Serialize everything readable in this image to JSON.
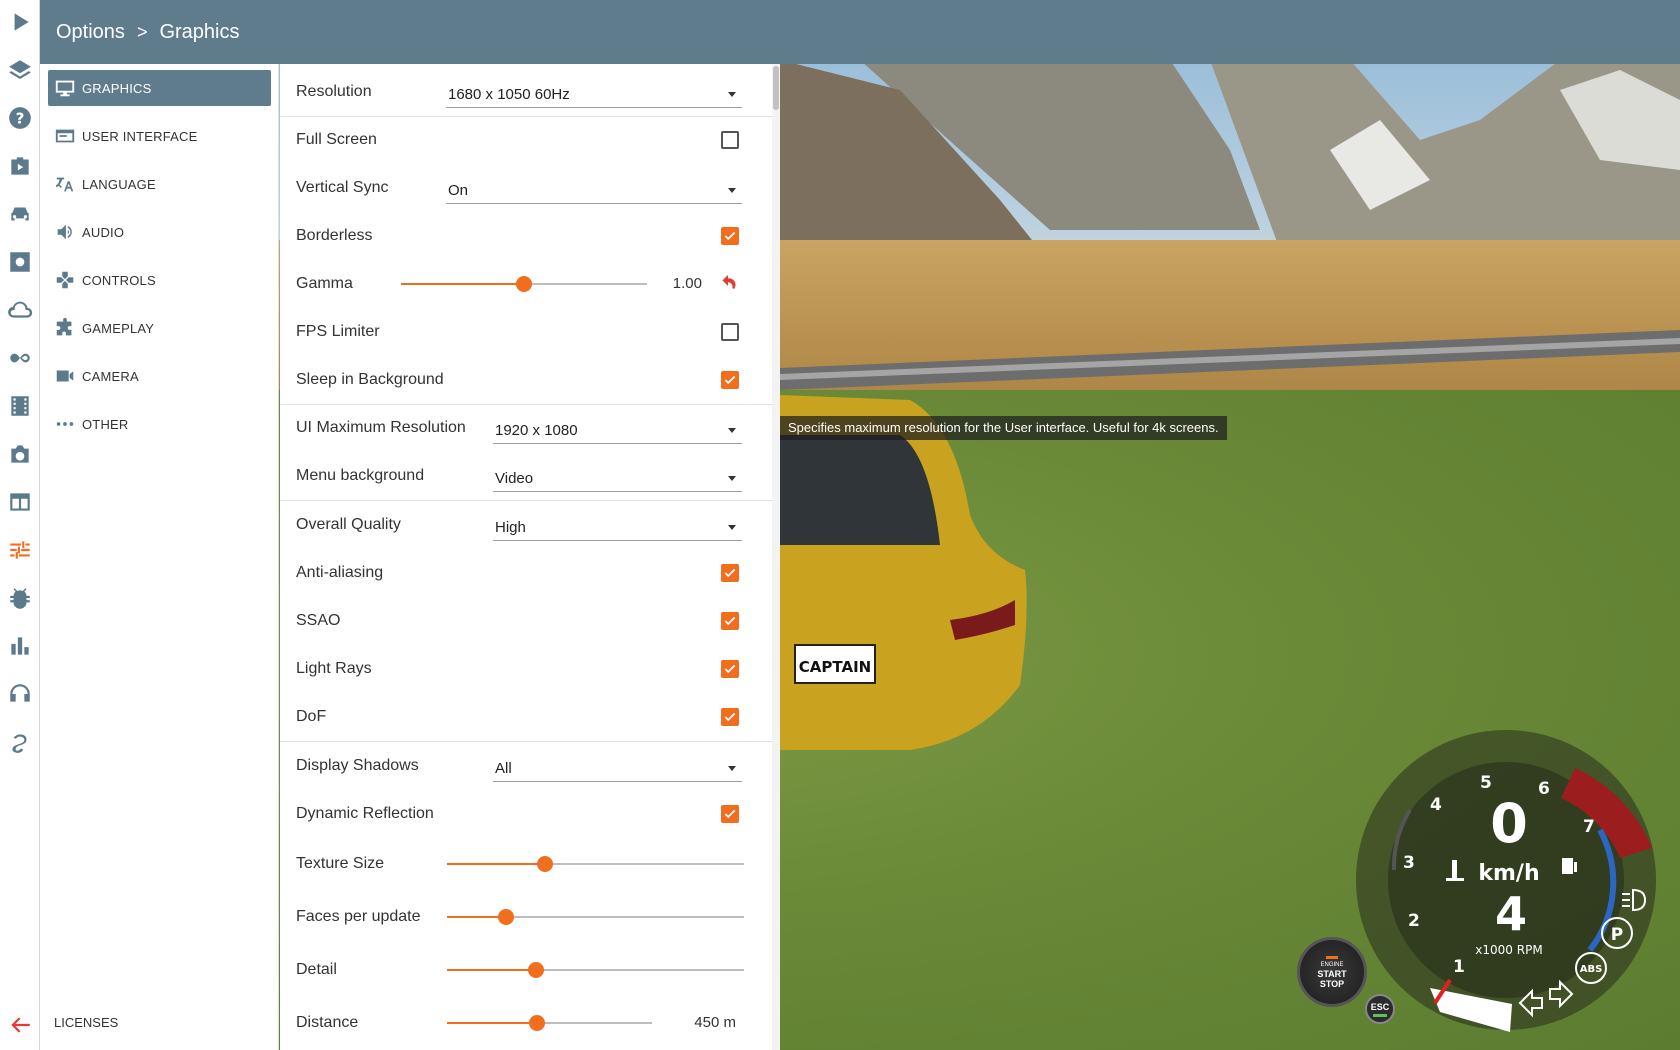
{
  "title": {
    "section": "Options",
    "separator": ">",
    "page": "Graphics"
  },
  "rail": {
    "items": [
      {
        "name": "play-icon"
      },
      {
        "name": "layers-icon"
      },
      {
        "name": "help-icon"
      },
      {
        "name": "missions-icon"
      },
      {
        "name": "vehicles-icon"
      },
      {
        "name": "vehicle-config-icon"
      },
      {
        "name": "cloud-icon"
      },
      {
        "name": "infinity-icon"
      },
      {
        "name": "film-icon"
      },
      {
        "name": "camera-icon"
      },
      {
        "name": "layout-icon"
      },
      {
        "name": "options-icon"
      },
      {
        "name": "bug-icon"
      },
      {
        "name": "stats-icon"
      },
      {
        "name": "headphones-icon"
      },
      {
        "name": "route-icon"
      }
    ],
    "active": "options-icon",
    "back": "back-arrow-icon"
  },
  "menu": {
    "items": [
      {
        "label": "GRAPHICS",
        "icon": "monitor-icon",
        "active": true
      },
      {
        "label": "USER INTERFACE",
        "icon": "ui-window-icon"
      },
      {
        "label": "LANGUAGE",
        "icon": "translate-icon"
      },
      {
        "label": "AUDIO",
        "icon": "speaker-icon"
      },
      {
        "label": "CONTROLS",
        "icon": "gamepad-icon"
      },
      {
        "label": "GAMEPLAY",
        "icon": "puzzle-icon"
      },
      {
        "label": "CAMERA",
        "icon": "video-camera-icon"
      },
      {
        "label": "OTHER",
        "icon": "more-icon"
      }
    ],
    "licenses": "LICENSES"
  },
  "settings": {
    "resolution": {
      "label": "Resolution",
      "value": "1680 x 1050 60Hz"
    },
    "full_screen": {
      "label": "Full Screen",
      "checked": false
    },
    "vsync": {
      "label": "Vertical Sync",
      "value": "On"
    },
    "borderless": {
      "label": "Borderless",
      "checked": true
    },
    "gamma": {
      "label": "Gamma",
      "value": "1.00",
      "level": 0.5
    },
    "fps_limiter": {
      "label": "FPS Limiter",
      "checked": false
    },
    "sleep_bg": {
      "label": "Sleep in Background",
      "checked": true
    },
    "ui_max_res": {
      "label": "UI Maximum Resolution",
      "value": "1920 x 1080"
    },
    "menu_bg": {
      "label": "Menu background",
      "value": "Video"
    },
    "overall_quality": {
      "label": "Overall Quality",
      "value": "High"
    },
    "anti_aliasing": {
      "label": "Anti-aliasing",
      "checked": true
    },
    "ssao": {
      "label": "SSAO",
      "checked": true
    },
    "light_rays": {
      "label": "Light Rays",
      "checked": true
    },
    "dof": {
      "label": "DoF",
      "checked": true
    },
    "display_shadows": {
      "label": "Display Shadows",
      "value": "All"
    },
    "dynamic_reflection": {
      "label": "Dynamic Reflection",
      "checked": true
    },
    "texture_size": {
      "label": "Texture Size",
      "level": 0.33
    },
    "faces_per_update": {
      "label": "Faces per update",
      "level": 0.2
    },
    "detail": {
      "label": "Detail",
      "level": 0.3
    },
    "distance": {
      "label": "Distance",
      "value": "450 m",
      "level": 0.44
    }
  },
  "tooltip": "Specifies maximum resolution for the User interface. Useful for 4k screens.",
  "hud": {
    "speed": "0",
    "unit": "km/h",
    "gear": "4",
    "rpm_label": "x1000 RPM",
    "rpm_ticks": [
      "1",
      "2",
      "3",
      "4",
      "5",
      "6",
      "7"
    ],
    "engine": {
      "line1": "ENGINE",
      "line2": "START",
      "line3": "STOP"
    },
    "esc": "ESC",
    "park": "P",
    "abs": "ABS",
    "plate": "CAPTAIN"
  },
  "colors": {
    "accent": "#f26e1f",
    "header": "#5f7c8d",
    "icon": "#5c7a8c"
  }
}
